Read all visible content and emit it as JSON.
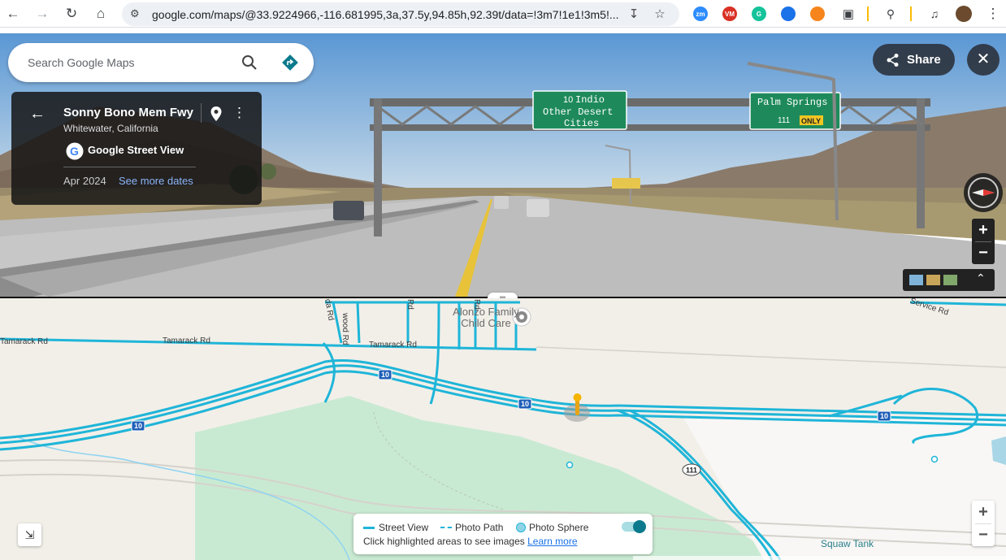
{
  "browser": {
    "url": "google.com/maps/@33.9224966,-116.681995,3a,37.5y,94.85h,92.39t/data=!3m7!1e1!3m5!...",
    "extensions": [
      {
        "name": "zoom-extension-icon",
        "label": "zm",
        "color": "#2d8cff"
      },
      {
        "name": "vm-extension-icon",
        "label": "VM",
        "color": "#d93025"
      },
      {
        "name": "grammarly-extension-icon",
        "label": "G",
        "color": "#15c39a"
      },
      {
        "name": "circle-extension-icon",
        "label": "",
        "color": "#1a73e8"
      },
      {
        "name": "metamask-extension-icon",
        "label": "",
        "color": "#f6851b"
      }
    ]
  },
  "search": {
    "placeholder": "Search Google Maps"
  },
  "share": {
    "label": "Share"
  },
  "info_card": {
    "title": "Sonny Bono Mem Fwy",
    "location": "Whitewater, California",
    "provider": "Google Street View",
    "date": "Apr 2024",
    "see_more": "See more dates"
  },
  "street_view": {
    "sign_left": [
      "10",
      "Indio",
      "Other Desert",
      "Cities"
    ],
    "sign_right": [
      "Palm Springs",
      "111",
      "ONLY"
    ]
  },
  "map": {
    "labels": {
      "tamarack_1": "Tamarack Rd",
      "tamarack_2": "Tamarack Rd",
      "tamarack_3": "Tamarack Rd",
      "wood_rd": "wood Rd",
      "rd_1": "Rd",
      "rd_2": "Rd",
      "rd_3": "da Rd",
      "service_rd": "Service Rd",
      "poi": "Alonzo Family Child Care",
      "squaw_tank": "Squaw Tank",
      "i10_1": "10",
      "i10_2": "10",
      "i10_3": "10",
      "i10_4": "10",
      "sr111": "111"
    },
    "colors": {
      "street_view_line": "#1fb5d8",
      "park": "#c9ead2",
      "land": "#f2efe9"
    }
  },
  "legend": {
    "street_view": "Street View",
    "photo_path": "Photo Path",
    "photo_sphere": "Photo Sphere",
    "hint": "Click highlighted areas to see images",
    "learn_more": "Learn more"
  }
}
